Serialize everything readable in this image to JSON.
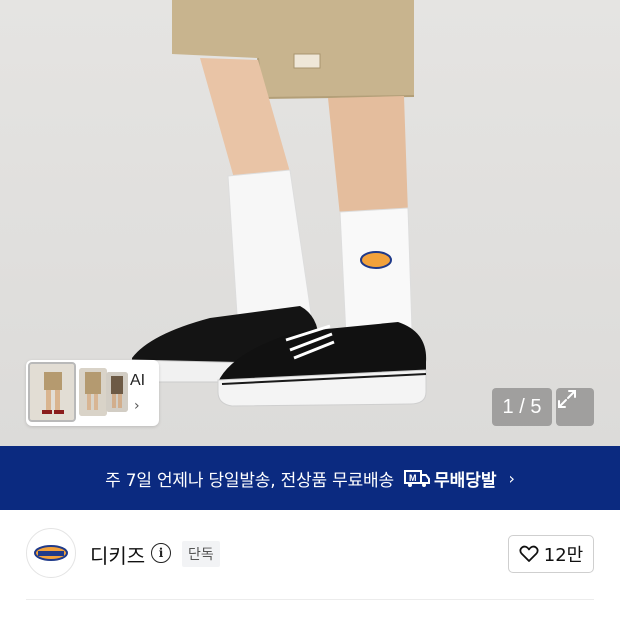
{
  "hero": {
    "image_alt": "product photo: white crew socks with logo worn with black canvas sneakers",
    "page_counter": "1 / 5"
  },
  "thumbnail_strip": {
    "ai_label": "AI",
    "chevron": "chevron-right-icon"
  },
  "banner": {
    "text": "주 7일 언제나 당일발송, 전상품 무료배송",
    "badge_label": "무배당발",
    "badge_icon": "delivery-truck-icon",
    "background": "#0b2a80"
  },
  "brand": {
    "name": "디키즈",
    "tag": "단독",
    "likes": "12만"
  },
  "icons": {
    "expand": "expand-icon",
    "info": "info-icon",
    "heart": "heart-icon"
  }
}
